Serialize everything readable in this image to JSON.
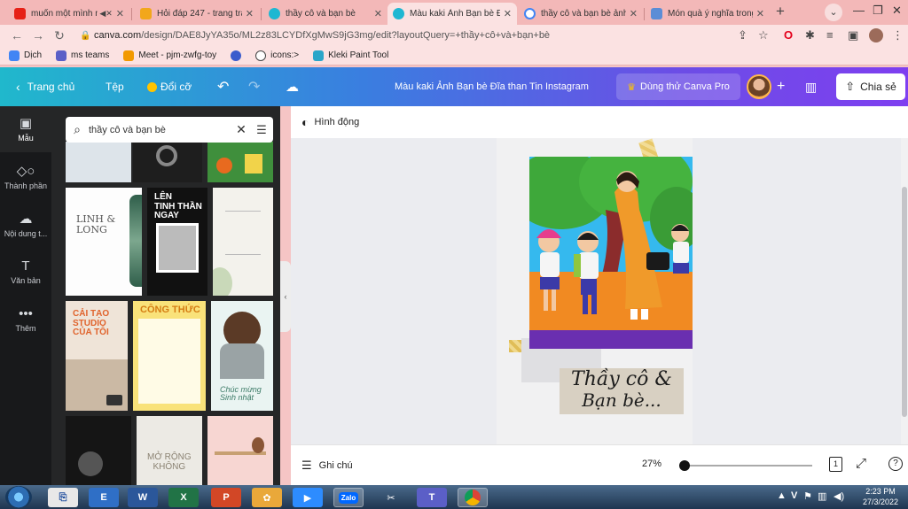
{
  "browser": {
    "tabs": [
      {
        "title": "muốn một mình nhì",
        "favicon": "youtube-icon",
        "color": "#e62117",
        "muted": true
      },
      {
        "title": "Hỏi đáp 247 - trang tra",
        "favicon": "hoidap-icon",
        "color": "#f2a71b"
      },
      {
        "title": "thầy cô và bạn bè",
        "favicon": "canva-icon",
        "color": "#1fb7d2"
      },
      {
        "title": "Màu kaki Ảnh Bạn bè Đĩ",
        "favicon": "canva-icon",
        "color": "#1fb7d2",
        "active": true
      },
      {
        "title": "thầy cô và bạn bè ảnh",
        "favicon": "google-icon",
        "color": "#4285f4"
      },
      {
        "title": "Món quà ý nghĩa trong",
        "favicon": "web-icon",
        "color": "#5b8dd6"
      }
    ],
    "new_tab": "+",
    "url_host": "canva.com",
    "url_path": "/design/DAE8JyYA35o/ML2z83LCYDfXgMwS9jG3mg/edit?layoutQuery=+thầy+cô+và+bạn+bè",
    "bookmarks": [
      {
        "label": "Dịch",
        "color": "#4285f4"
      },
      {
        "label": "ms teams",
        "color": "#5b5fc7"
      },
      {
        "label": "Meet - pjm-zwfg-toy",
        "color": "#f29900"
      },
      {
        "label": "",
        "color": "#3b5ccc"
      },
      {
        "label": "icons:>",
        "color": "#444444"
      },
      {
        "label": "Kleki Paint Tool",
        "color": "#2aa6c9"
      }
    ]
  },
  "canva": {
    "header": {
      "home": "Trang chủ",
      "file": "Tệp",
      "resize": "Đổi cỡ",
      "title": "Màu kaki Ảnh Bạn bè Đĩa than Tin Instagram",
      "try_pro": "Dùng thử Canva Pro",
      "share": "Chia sẻ"
    },
    "rail": [
      {
        "label": "Mẫu",
        "icon": "template-icon",
        "active": true
      },
      {
        "label": "Thành phần",
        "icon": "elements-icon"
      },
      {
        "label": "Nội dung t...",
        "icon": "upload-icon"
      },
      {
        "label": "Văn bản",
        "icon": "text-icon"
      },
      {
        "label": "Thêm",
        "icon": "more-icon"
      }
    ],
    "search": {
      "query": "thầy cô và bạn bè"
    },
    "templates": {
      "linh_long": "LINH &\nLONG",
      "len_tinh_than": "LÊN\nTINH THẦN\nNGAY",
      "cai_tao": "CẢI TẠO\nSTUDIO\nCỦA TÔI",
      "cong_thuc": "CÔNG THỨC",
      "chuc_mung": "Chúc mừng\nSinh nhật",
      "mo_rong": "MỞ RỘNG\nKHÔNG"
    },
    "animation": "Hình động",
    "caption": {
      "line1": "Thầy cô &",
      "line2": "Bạn bè..."
    },
    "notes": "Ghi chú",
    "zoom": "27%",
    "page": "1",
    "help": "?"
  },
  "taskbar": {
    "apps": [
      "ie-icon",
      "word-icon",
      "excel-icon",
      "powerpoint-icon",
      "chrome-profile-icon",
      "zoom-icon",
      "zalo-icon",
      "paint-icon",
      "teams-icon",
      "chrome-icon"
    ],
    "time": "2:23 PM",
    "date": "27/3/2022",
    "tray_lang": "V"
  }
}
